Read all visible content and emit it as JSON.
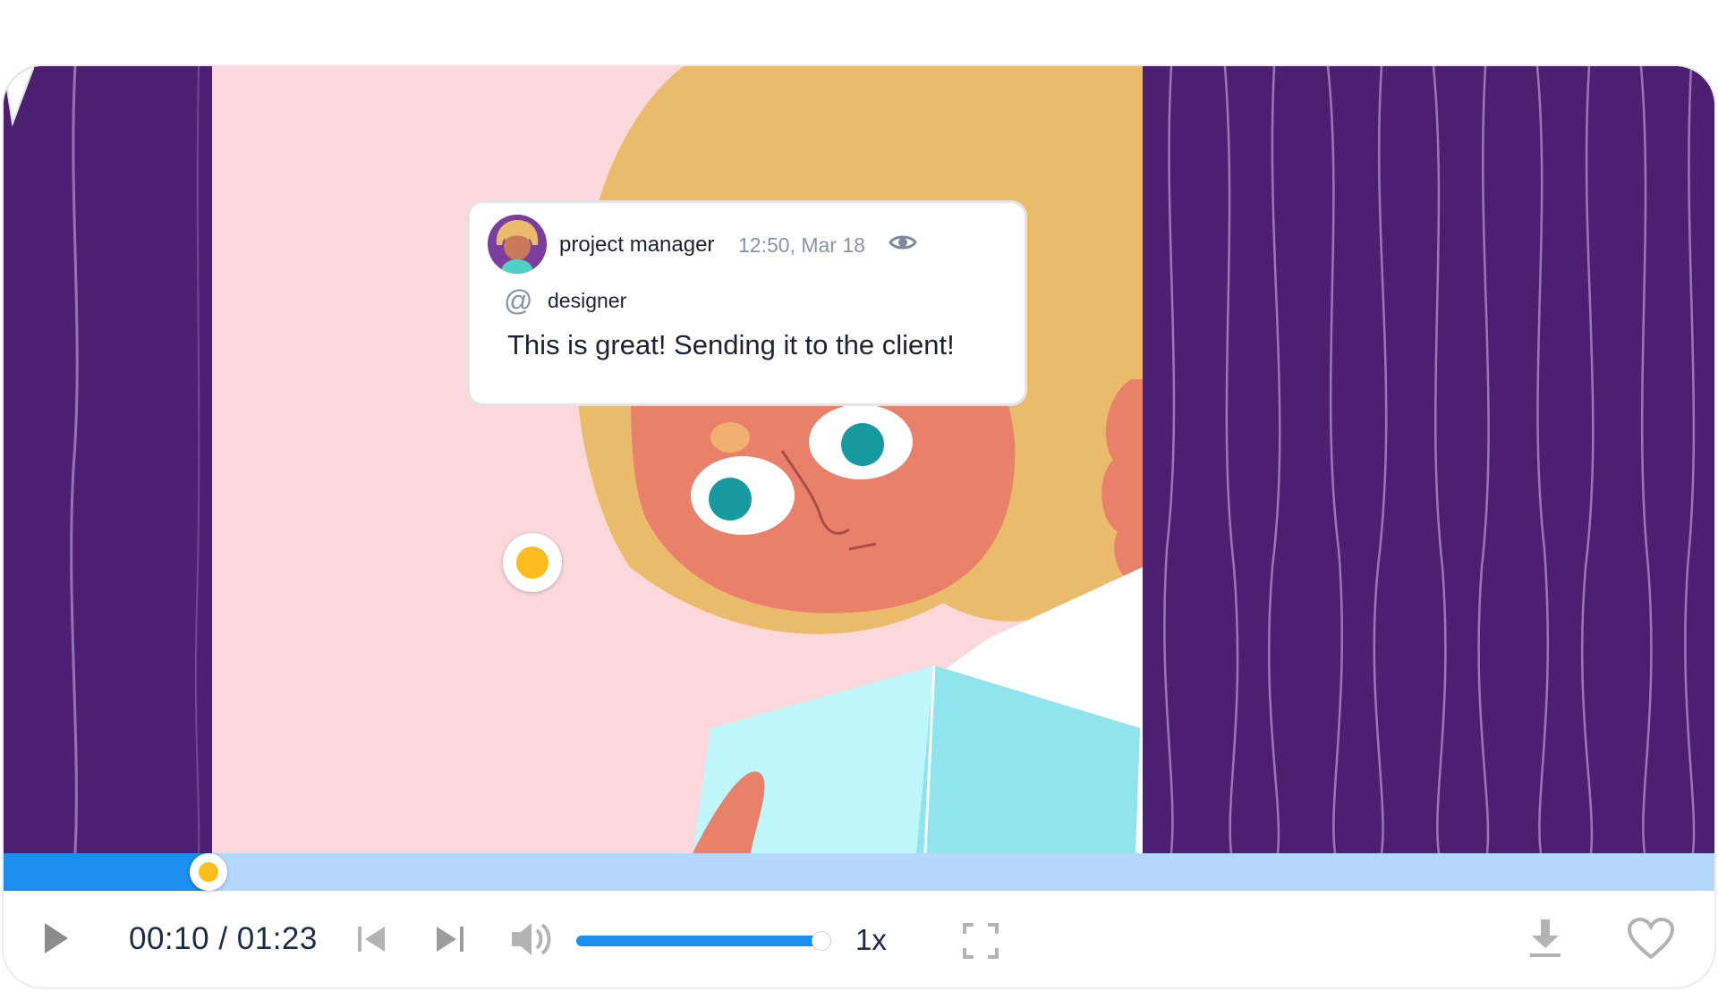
{
  "comment": {
    "author": "project manager",
    "timestamp": "12:50, Mar 18",
    "mention_symbol": "@",
    "mention": "designer",
    "message": "This is great! Sending it to the client!",
    "icons": {
      "visibility": "eye-icon",
      "mention": "at-icon"
    }
  },
  "player": {
    "current_time": "00:10",
    "separator": " / ",
    "duration": "01:23",
    "playback_progress": 0.12,
    "volume_level": 0.98,
    "speed": "1x",
    "icons": [
      "play-icon",
      "skip-back-icon",
      "skip-forward-icon",
      "volume-icon",
      "fullscreen-icon",
      "download-icon",
      "heart-icon"
    ]
  },
  "colors": {
    "progress_fill": "#1b8ef0",
    "progress_track": "#b4d8fb",
    "marker": "#fbbd1b",
    "curtain": "#4d1f70",
    "text_dark": "#1d2a48"
  }
}
